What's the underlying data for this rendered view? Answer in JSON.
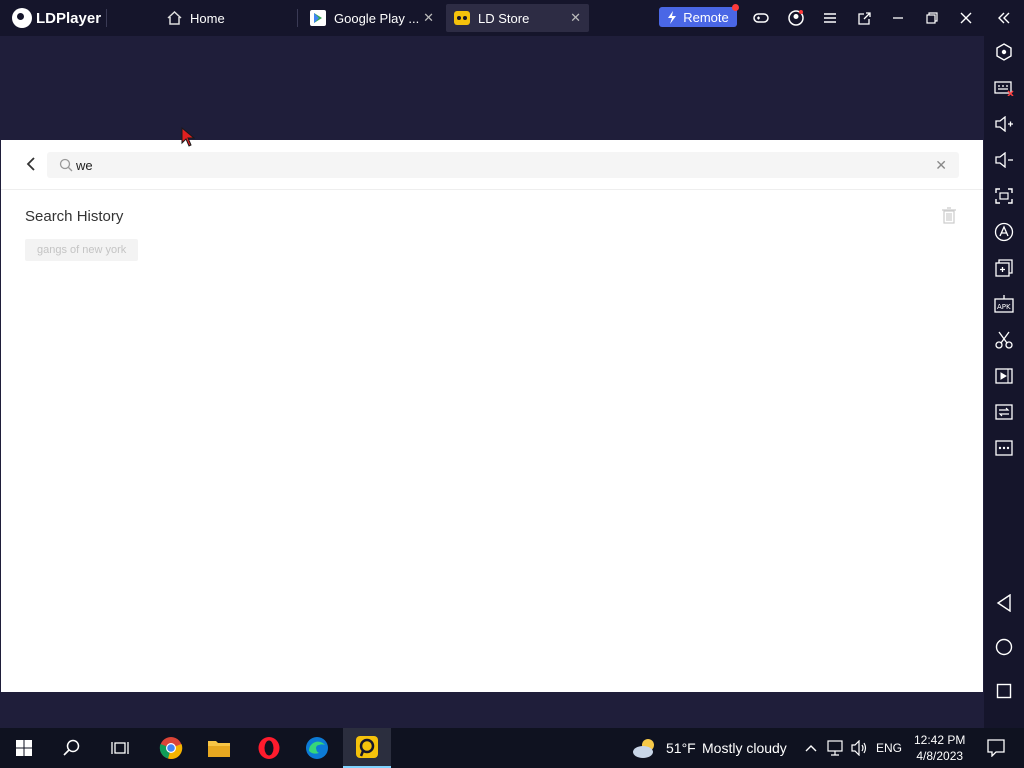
{
  "app": {
    "name": "LDPlayer"
  },
  "tabs": [
    {
      "label": "Home",
      "icon": "home-icon"
    },
    {
      "label": "Google Play ...",
      "icon": "google-play-icon"
    },
    {
      "label": "LD Store",
      "icon": "ld-store-icon"
    }
  ],
  "toolbar": {
    "remote_label": "Remote"
  },
  "search": {
    "value": "we",
    "placeholder": ""
  },
  "history": {
    "title": "Search History",
    "items": [
      "gangs of new york"
    ]
  },
  "taskbar": {
    "weather_temp": "51°F",
    "weather_desc": "Mostly cloudy",
    "lang": "ENG",
    "time": "12:42 PM",
    "date": "4/8/2023"
  },
  "colors": {
    "titlebar": "#15152b",
    "emulator_bg": "#1f1e3a",
    "remote_btn": "#4a67e6",
    "taskbar": "#0f1220"
  }
}
